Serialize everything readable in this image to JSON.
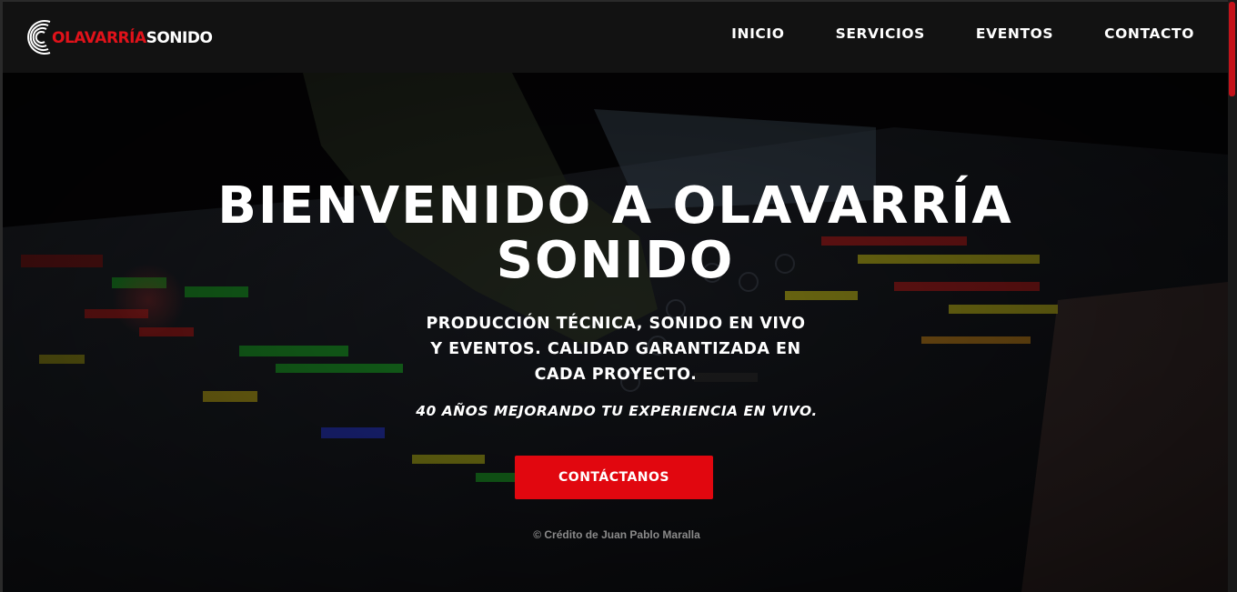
{
  "logo": {
    "part_red": "OLAVARRÍA",
    "part_white": "SONIDO"
  },
  "nav": [
    {
      "label": "INICIO"
    },
    {
      "label": "SERVICIOS"
    },
    {
      "label": "EVENTOS"
    },
    {
      "label": "CONTACTO"
    }
  ],
  "hero": {
    "title_line1": "BIENVENIDO A OLAVARRÍA",
    "title_line2": "SONIDO",
    "subtitle_line1": "PRODUCCIÓN TÉCNICA, SONIDO EN VIVO",
    "subtitle_line2": "Y EVENTOS. CALIDAD GARANTIZADA EN",
    "subtitle_line3": "CADA PROYECTO.",
    "tagline": "40 AÑOS MEJORANDO TU EXPERIENCIA EN VIVO.",
    "cta_label": "CONTÁCTANOS",
    "credit": "© Crédito de Juan Pablo Maralla"
  },
  "colors": {
    "accent": "#e1070f",
    "header_bg": "#121212",
    "text": "#ffffff"
  },
  "icons": {
    "logo_mark": "concentric-arcs-logo-icon"
  }
}
